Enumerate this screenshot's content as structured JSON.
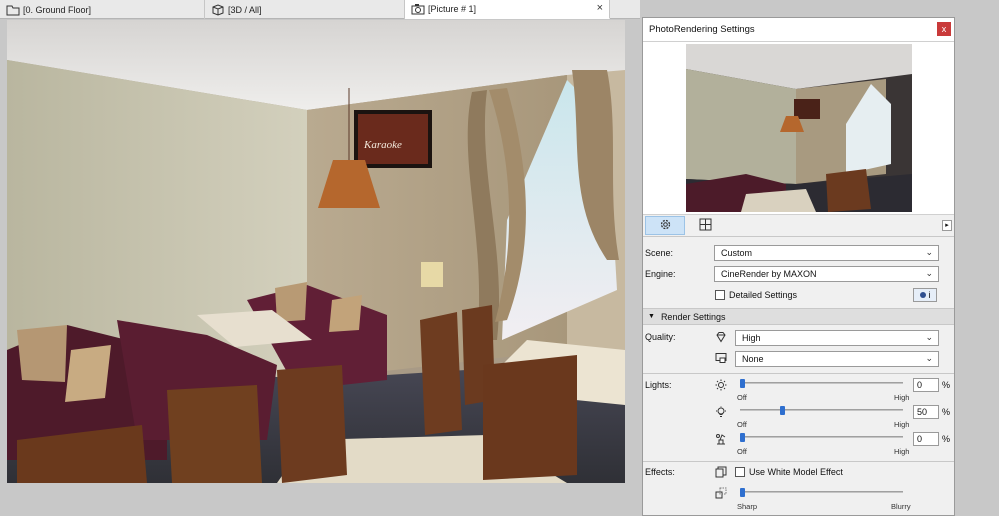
{
  "tabs": [
    {
      "label": "[0. Ground Floor]",
      "icon": "floorplan-icon"
    },
    {
      "label": "[3D / All]",
      "icon": "3d-cube-icon"
    },
    {
      "label": "[Picture # 1]",
      "icon": "camera-icon",
      "active": true
    }
  ],
  "tab_close": "×",
  "panel": {
    "title": "PhotoRendering Settings",
    "close": "x",
    "scene_label": "Scene:",
    "scene_value": "Custom",
    "engine_label": "Engine:",
    "engine_value": "CineRender by MAXON",
    "detailed_settings": "Detailed Settings",
    "info_button": "i",
    "render_settings_header": "Render Settings",
    "quality_label": "Quality:",
    "quality_value": "High",
    "quality_second_value": "None",
    "lights_label": "Lights:",
    "lights": [
      {
        "icon": "sun-icon",
        "value": "0",
        "level": 0.0
      },
      {
        "icon": "bulb-icon",
        "value": "50",
        "level": 0.25
      },
      {
        "icon": "lamp-icon",
        "value": "0",
        "level": 0.0
      }
    ],
    "off": "Off",
    "high": "High",
    "percent": "%",
    "effects_label": "Effects:",
    "white_model": "Use White Model Effect",
    "sharp": "Sharp",
    "blurry": "Blurry",
    "blur_level": 0.0
  },
  "colors": {
    "accent": "#2f6fcf",
    "close": "#c93a3a"
  }
}
